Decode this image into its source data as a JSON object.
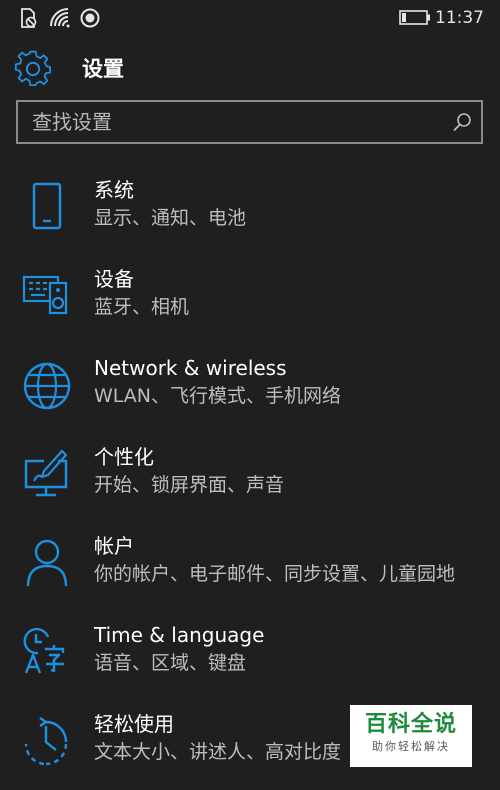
{
  "status_bar": {
    "time": "11:37",
    "icons": [
      "no-sim-icon",
      "wifi-icon",
      "location-icon",
      "battery-icon"
    ]
  },
  "header": {
    "title": "设置",
    "icon": "gear-icon"
  },
  "search": {
    "placeholder": "查找设置",
    "value": ""
  },
  "categories": [
    {
      "title": "系统",
      "subtitle": "显示、通知、电池",
      "icon": "phone-icon"
    },
    {
      "title": "设备",
      "subtitle": "蓝牙、相机",
      "icon": "devices-icon"
    },
    {
      "title": "Network & wireless",
      "subtitle": "WLAN、飞行模式、手机网络",
      "icon": "globe-icon"
    },
    {
      "title": "个性化",
      "subtitle": "开始、锁屏界面、声音",
      "icon": "personalization-icon"
    },
    {
      "title": "帐户",
      "subtitle": "你的帐户、电子邮件、同步设置、儿童园地",
      "icon": "person-icon"
    },
    {
      "title": "Time & language",
      "subtitle": "语音、区域、键盘",
      "icon": "time-language-icon"
    },
    {
      "title": "轻松使用",
      "subtitle": "文本大小、讲述人、高对比度",
      "icon": "ease-of-access-icon"
    }
  ],
  "watermark": {
    "title": "百科全说",
    "subtitle": "助你轻松解决"
  },
  "colors": {
    "background": "#1f1f1f",
    "accent": "#1e90e0",
    "text": "#ffffff",
    "subtext": "#bdbdbd"
  }
}
